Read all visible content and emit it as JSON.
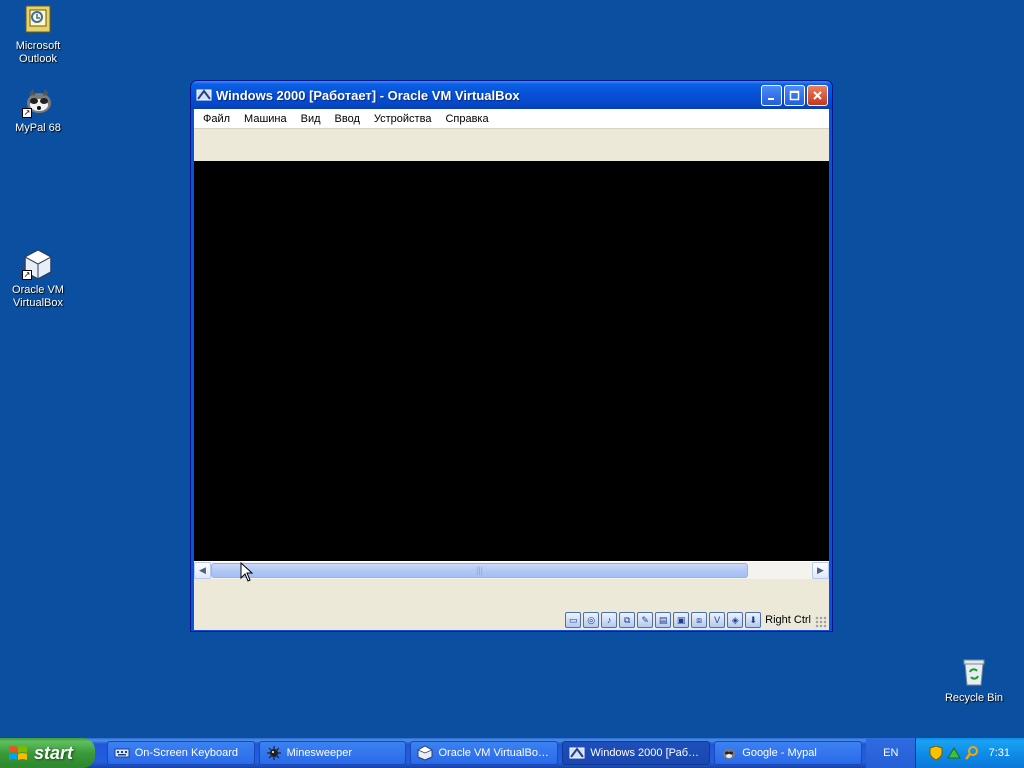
{
  "desktop": {
    "icons": [
      {
        "label": "Microsoft\nOutlook",
        "line1": "Microsoft",
        "line2": "Outlook",
        "icon": "outlook-icon"
      },
      {
        "label": "MyPal 68",
        "line1": "MyPal 68",
        "icon": "mypal-icon"
      },
      {
        "label": "Oracle VM VirtualBox",
        "line1": "Oracle VM",
        "line2": "VirtualBox",
        "icon": "virtualbox-icon"
      },
      {
        "label": "Recycle Bin",
        "line1": "Recycle Bin",
        "icon": "recycle-bin-icon"
      }
    ]
  },
  "window": {
    "title": "Windows 2000 [Работает] - Oracle VM VirtualBox",
    "menu": [
      "Файл",
      "Машина",
      "Вид",
      "Ввод",
      "Устройства",
      "Справка"
    ],
    "status": {
      "host_key": "Right Ctrl",
      "icons": [
        "hard-disk-icon",
        "optical-disk-icon",
        "audio-icon",
        "network-icon",
        "usb-icon",
        "shared-folders-icon",
        "display-icon",
        "video-capture-icon",
        "virtualization-icon",
        "mouse-integration-icon",
        "keyboard-capture-icon"
      ]
    }
  },
  "taskbar": {
    "start_label": "start",
    "tasks": [
      {
        "label": "On-Screen Keyboard",
        "icon": "keyboard-icon",
        "active": false
      },
      {
        "label": "Minesweeper",
        "icon": "minesweeper-icon",
        "active": false
      },
      {
        "label": "Oracle VM VirtualBo…",
        "icon": "virtualbox-icon",
        "active": false
      },
      {
        "label": "Windows 2000 [Раб…",
        "icon": "vbox-vm-icon",
        "active": true
      },
      {
        "label": "Google - Mypal",
        "icon": "mypal-icon",
        "active": false
      }
    ],
    "language": "EN",
    "clock": "7:31"
  },
  "colors": {
    "desktop": "#0b50a0",
    "titlebar": "#0750d6",
    "taskbar": "#245edb",
    "start": "#3a9b3a"
  }
}
